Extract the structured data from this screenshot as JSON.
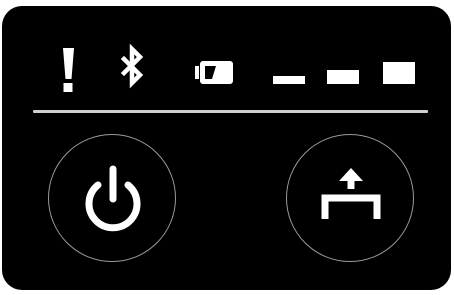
{
  "device_panel": {
    "status_indicators": {
      "error_icon": "exclamation-icon",
      "bluetooth_icon": "bluetooth-icon",
      "battery_icon": "battery-icon",
      "signal_levels": 3
    },
    "buttons": {
      "power_icon": "power-icon",
      "feed_icon": "paper-feed-icon"
    },
    "colors": {
      "panel": "#000000",
      "glyph": "#ffffff",
      "divider": "#cfcfcf",
      "button_ring": "#9a9a9a"
    }
  }
}
